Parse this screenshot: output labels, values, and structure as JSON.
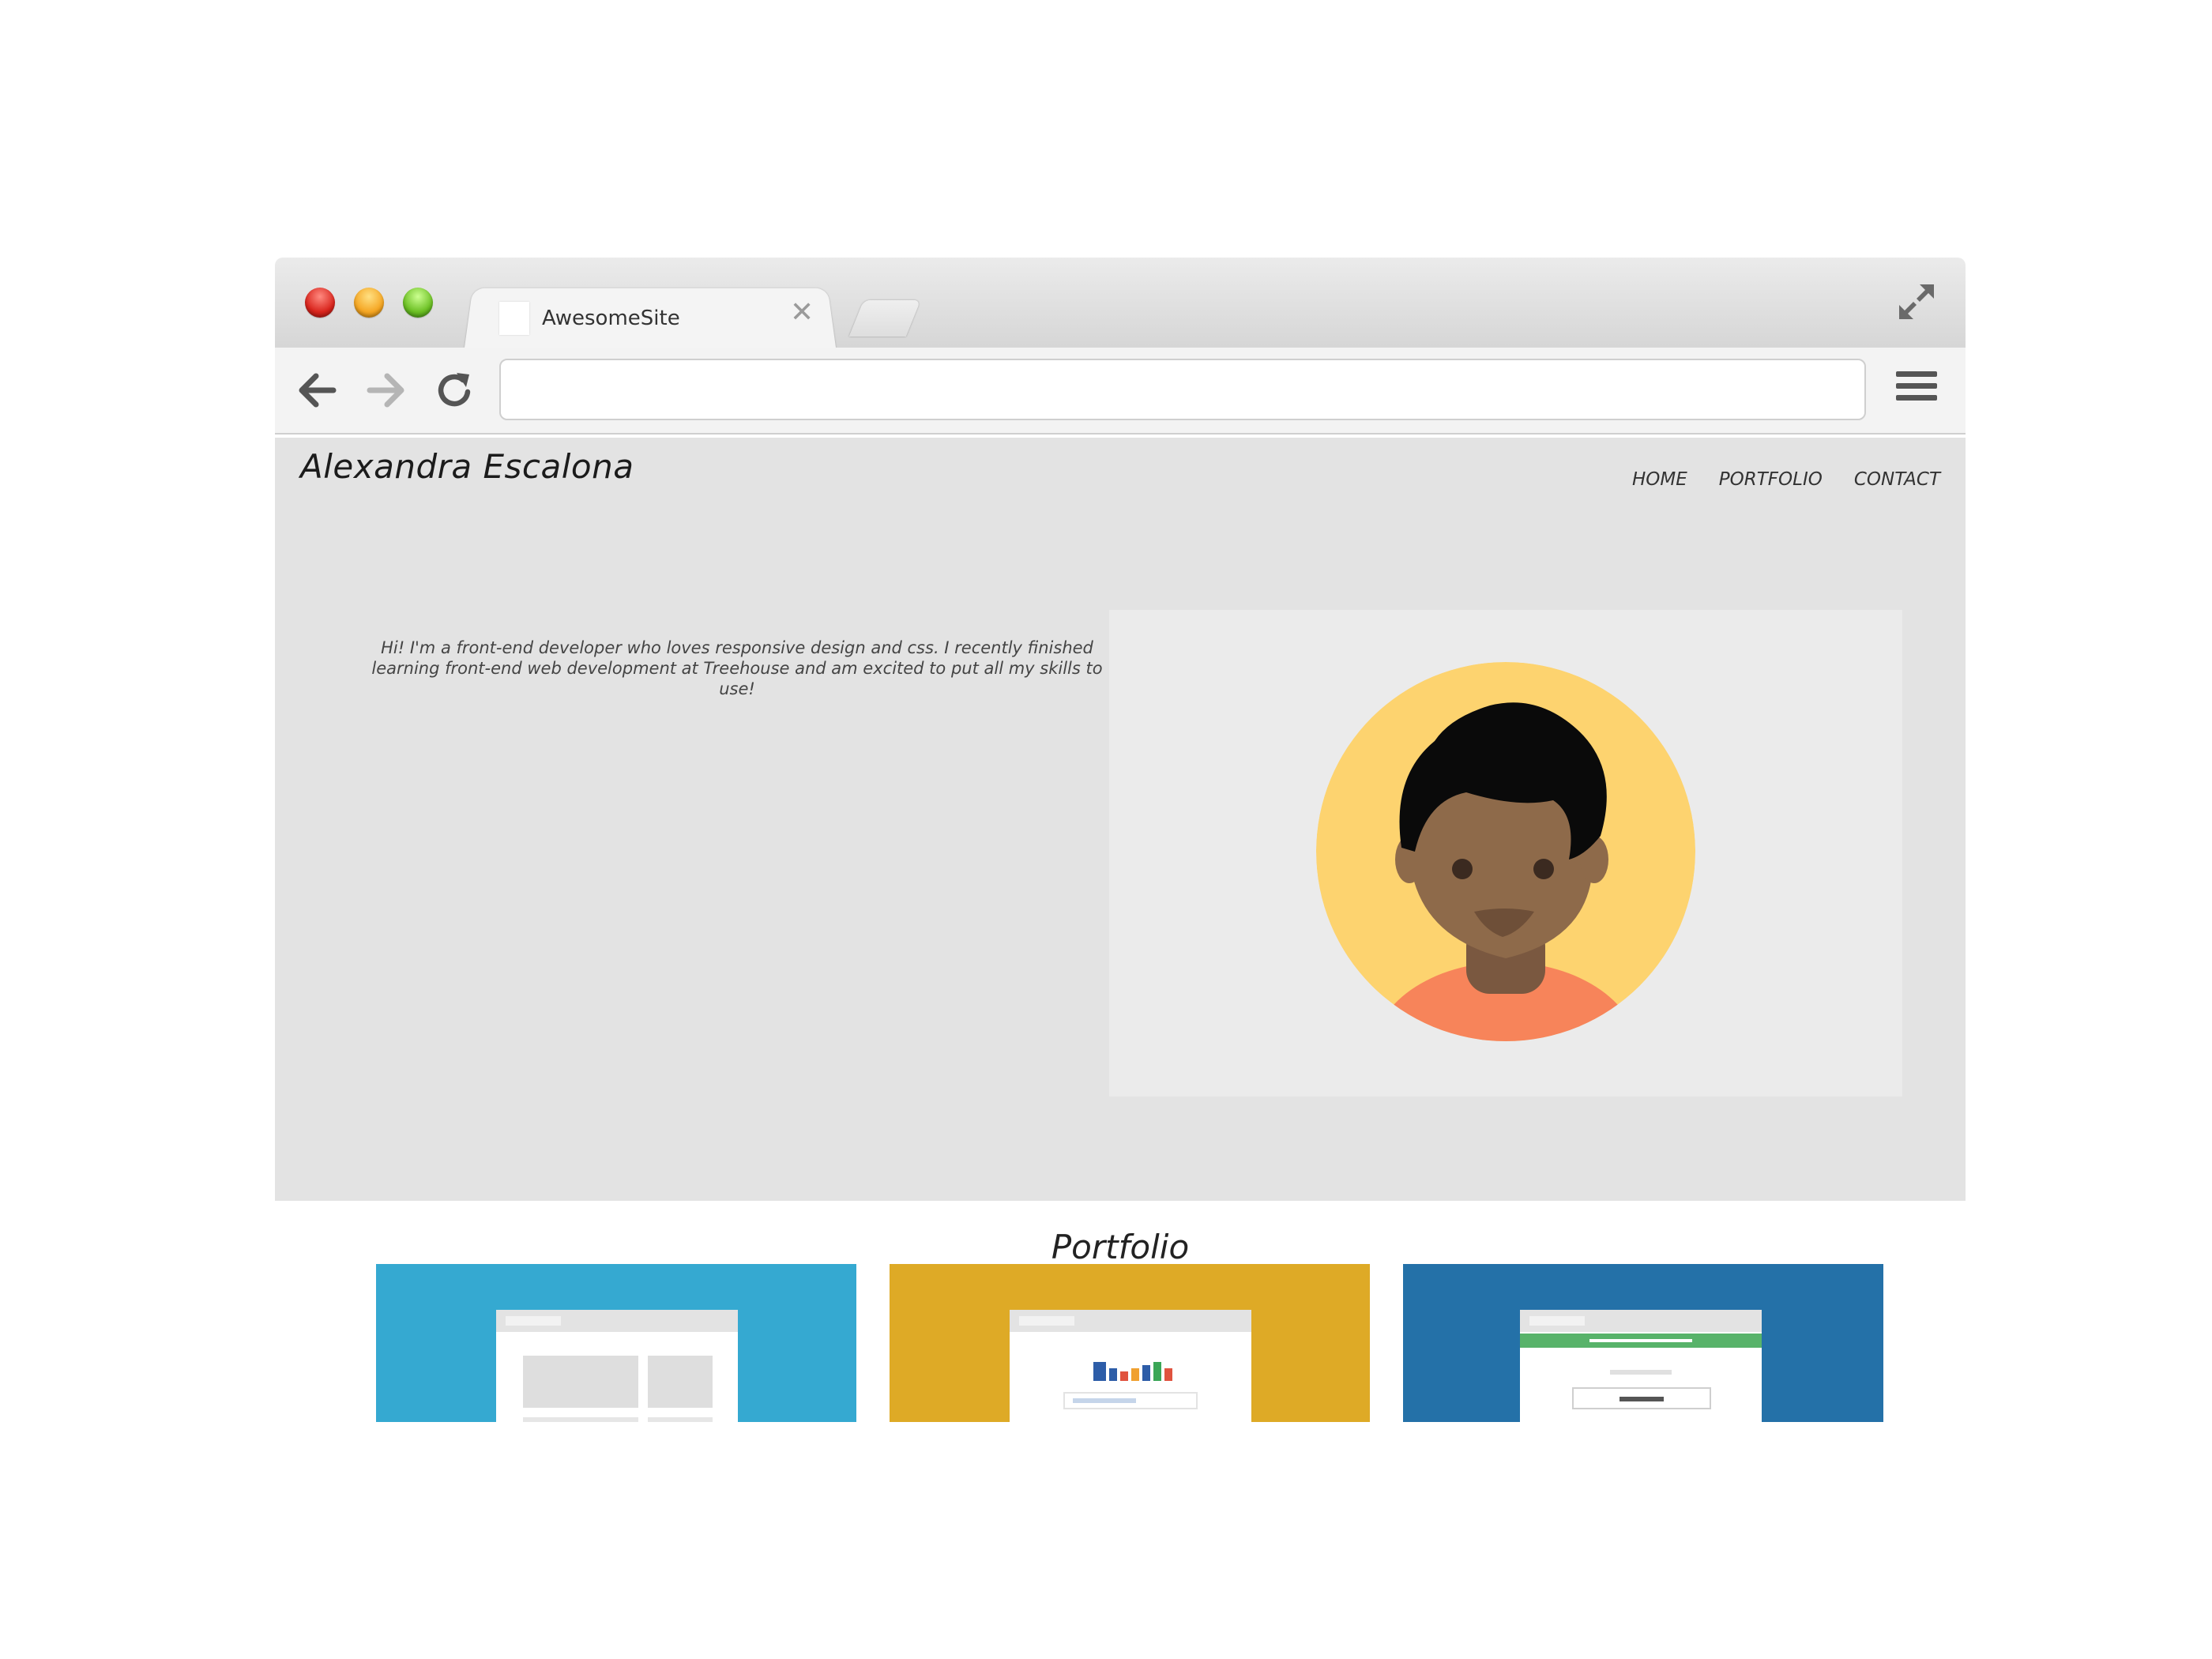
{
  "browser": {
    "tab_title": "AwesomeSite",
    "tab_close": "✕",
    "url": "",
    "traffic_lights": {
      "red": "#d9251d",
      "yellow": "#f5a623",
      "green": "#6cc024"
    }
  },
  "site": {
    "name": "Alexandra Escalona",
    "nav": [
      {
        "label": "HOME"
      },
      {
        "label": "PORTFOLIO"
      },
      {
        "label": "CONTACT"
      }
    ],
    "intro": "Hi! I'm a front-end developer who loves responsive design and css. I recently finished learning front-end web development at Treehouse and am excited to put all my skills to use!",
    "hero_background": "#e3e3e3",
    "avatar": {
      "bg": "#fdd36f",
      "skin": "#8e6a4a",
      "hair": "#0a0a0a",
      "shirt": "#f7845a"
    },
    "portfolio_heading": "Portfolio",
    "portfolio_cards": [
      {
        "color": "#35a9d1",
        "icon": "website-layout-thumbnail-icon"
      },
      {
        "color": "#deaa26",
        "icon": "chart-thumbnail-icon"
      },
      {
        "color": "#2471a8",
        "icon": "form-thumbnail-icon"
      }
    ]
  }
}
